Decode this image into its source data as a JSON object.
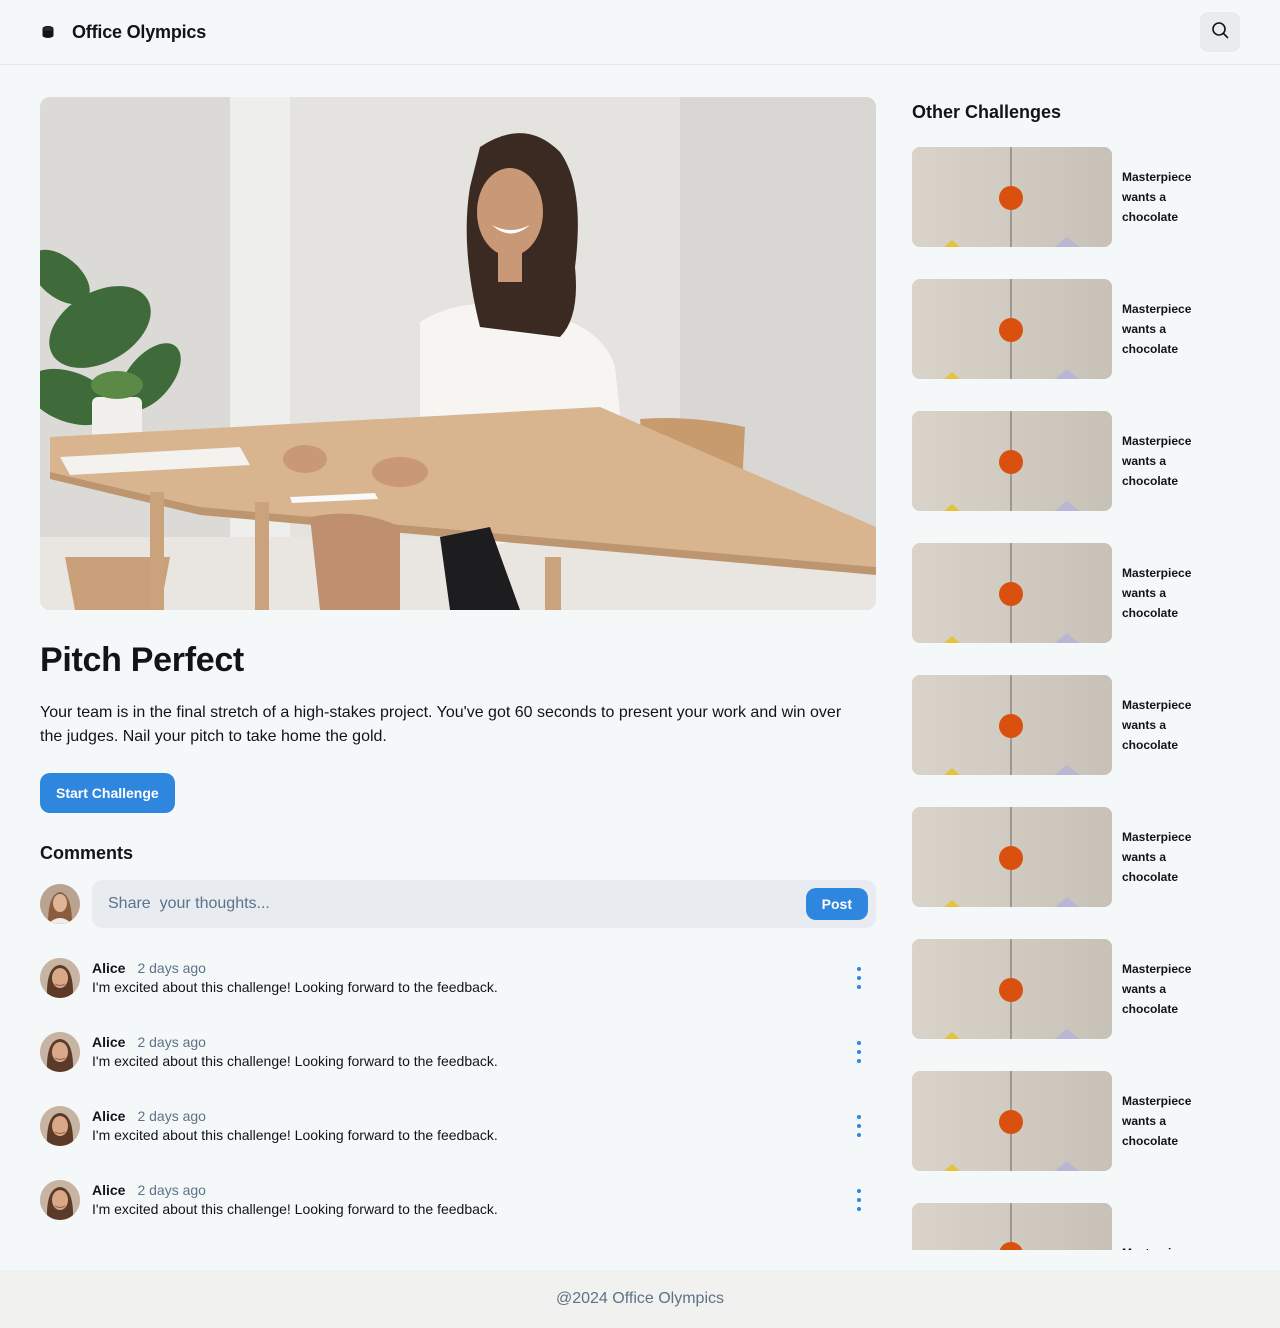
{
  "header": {
    "app_title": "Office Olympics",
    "logo_icon": "cylinder-icon",
    "search_icon": "search-icon"
  },
  "challenge": {
    "hero_image": "woman-smiling-at-desk-photo",
    "title": "Pitch Perfect",
    "description": "Your team is in the final stretch of a high-stakes project. You've got 60 seconds to present your work and win over the judges. Nail your pitch to take home the gold.",
    "start_label": "Start Challenge"
  },
  "comments": {
    "heading": "Comments",
    "placeholder": "Share  your thoughts...",
    "post_label": "Post",
    "items": [
      {
        "author": "Alice",
        "time": "2 days ago",
        "text": "I'm excited about this challenge! Looking forward to the feedback."
      },
      {
        "author": "Alice",
        "time": "2 days ago",
        "text": "I'm excited about this challenge! Looking forward to the feedback."
      },
      {
        "author": "Alice",
        "time": "2 days ago",
        "text": "I'm excited about this challenge! Looking forward to the feedback."
      },
      {
        "author": "Alice",
        "time": "2 days ago",
        "text": "I'm excited about this challenge! Looking forward to the feedback."
      }
    ]
  },
  "sidebar": {
    "heading": "Other Challenges",
    "items": [
      {
        "title": "Masterpiece wants a chocolate"
      },
      {
        "title": "Masterpiece wants a chocolate"
      },
      {
        "title": "Masterpiece wants a chocolate"
      },
      {
        "title": "Masterpiece wants a chocolate"
      },
      {
        "title": "Masterpiece wants a chocolate"
      },
      {
        "title": "Masterpiece wants a chocolate"
      },
      {
        "title": "Masterpiece wants a chocolate"
      },
      {
        "title": "Masterpiece wants a chocolate"
      },
      {
        "title": "Masterpiece"
      }
    ]
  },
  "footer": {
    "text": "@2024 Office Olympics"
  },
  "colors": {
    "accent": "#2f86de",
    "background": "#f5f8f9",
    "muted_text": "#5d7289",
    "thumb_dot": "#d9500f"
  }
}
